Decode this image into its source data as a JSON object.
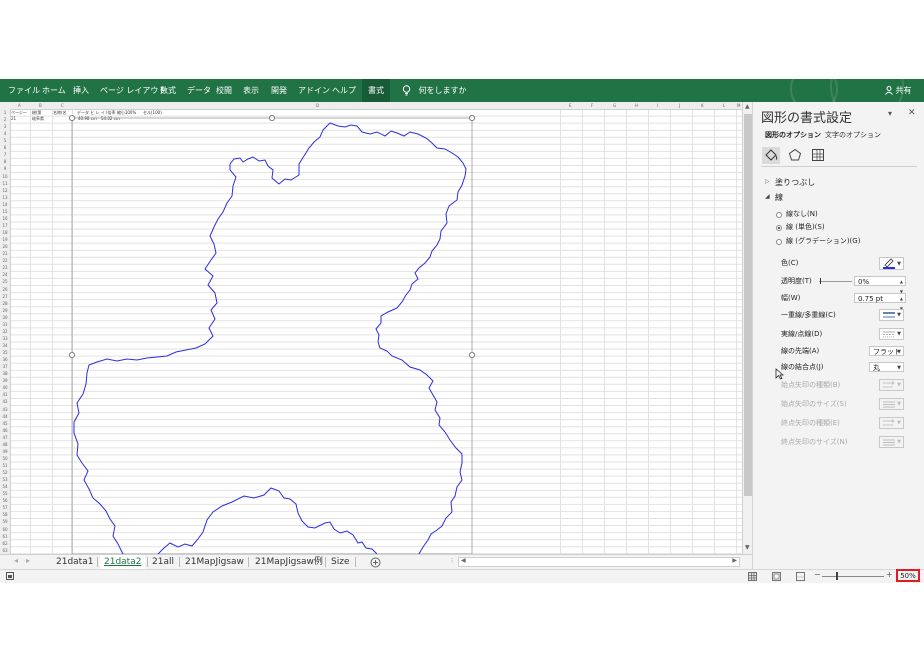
{
  "ribbon": {
    "tabs": [
      "ファイル",
      "ホーム",
      "挿入",
      "ページ レイアウト",
      "数式",
      "データ",
      "校閲",
      "表示",
      "開発",
      "アドイン",
      "ヘルプ",
      "書式"
    ],
    "active_tab": "書式",
    "tell_me": "何をしますか",
    "share": "共有",
    "colors": {
      "ribbon_bg": "#217346",
      "active_tab_bg": "#185c37"
    }
  },
  "sheet": {
    "columns": [
      "A",
      "B",
      "C",
      "D",
      "E",
      "F",
      "G",
      "H",
      "I",
      "J",
      "K",
      "L",
      "M"
    ],
    "row_numbers": [
      "1",
      "2",
      "3",
      "4",
      "5",
      "6",
      "7",
      "8",
      "9",
      "10",
      "11",
      "12",
      "13",
      "14",
      "15",
      "16",
      "17",
      "18",
      "19",
      "20",
      "21",
      "22",
      "23",
      "24",
      "25",
      "26",
      "27",
      "28",
      "29",
      "30",
      "31",
      "32",
      "33",
      "34",
      "35",
      "36",
      "37",
      "38",
      "39",
      "40",
      "41",
      "42",
      "43",
      "44",
      "45",
      "46",
      "47",
      "48",
      "49",
      "50",
      "51",
      "52",
      "53",
      "54",
      "55",
      "56",
      "57",
      "58",
      "59",
      "60",
      "61",
      "62",
      "63"
    ],
    "tiny_cells": [
      "ページー",
      "総(第",
      "名称(名",
      "データ ヒ レ イ",
      "(倍率 縮小100%",
      "セル(100)",
      "21",
      "岐阜県",
      "40.98 cm",
      "54.02 cm"
    ],
    "shape_name": "岐阜県 outline",
    "shape_color": "#2c2ce0"
  },
  "sheet_tabs": {
    "tabs": [
      "21data1",
      "21data2",
      "21all",
      "21MapJigsaw",
      "21MapJigsaw例",
      "Size"
    ],
    "active": "21data2",
    "add_icon": "plus-circle-icon",
    "nav_prev": "◂",
    "nav_next": "▸"
  },
  "statusbar": {
    "zoom_text": "50%",
    "zoom_minus": "−",
    "zoom_plus": "+"
  },
  "pane": {
    "title": "図形の書式設定",
    "close": "✕",
    "collapse": "▾",
    "tab_shape_options": "図形のオプション",
    "tab_text_options": "文字のオプション",
    "icons": [
      "fill-line-icon",
      "effects-icon",
      "size-properties-icon"
    ],
    "section_fill": "塗りつぶし",
    "section_line": "線",
    "radio_options": [
      "線なし(N)",
      "線 (単色)(S)",
      "線 (グラデーション)(G)"
    ],
    "radio_selected": "線 (単色)(S)",
    "props": {
      "color_label": "色(C)",
      "transparency_label": "透明度(T)",
      "transparency_value": "0%",
      "width_label": "幅(W)",
      "width_value": "0.75 pt",
      "compound_label": "一重線/多重線(C)",
      "dash_label": "実線/点線(D)",
      "cap_label": "線の先端(A)",
      "cap_value": "フラット",
      "join_label": "線の結合点(J)",
      "join_value": "丸",
      "begin_arrow_type": "始点矢印の種類(B)",
      "begin_arrow_size": "始点矢印のサイズ(S)",
      "end_arrow_type": "終点矢印の種類(E)",
      "end_arrow_size": "終点矢印のサイズ(N)"
    },
    "line_color": "#2c2ce0"
  }
}
